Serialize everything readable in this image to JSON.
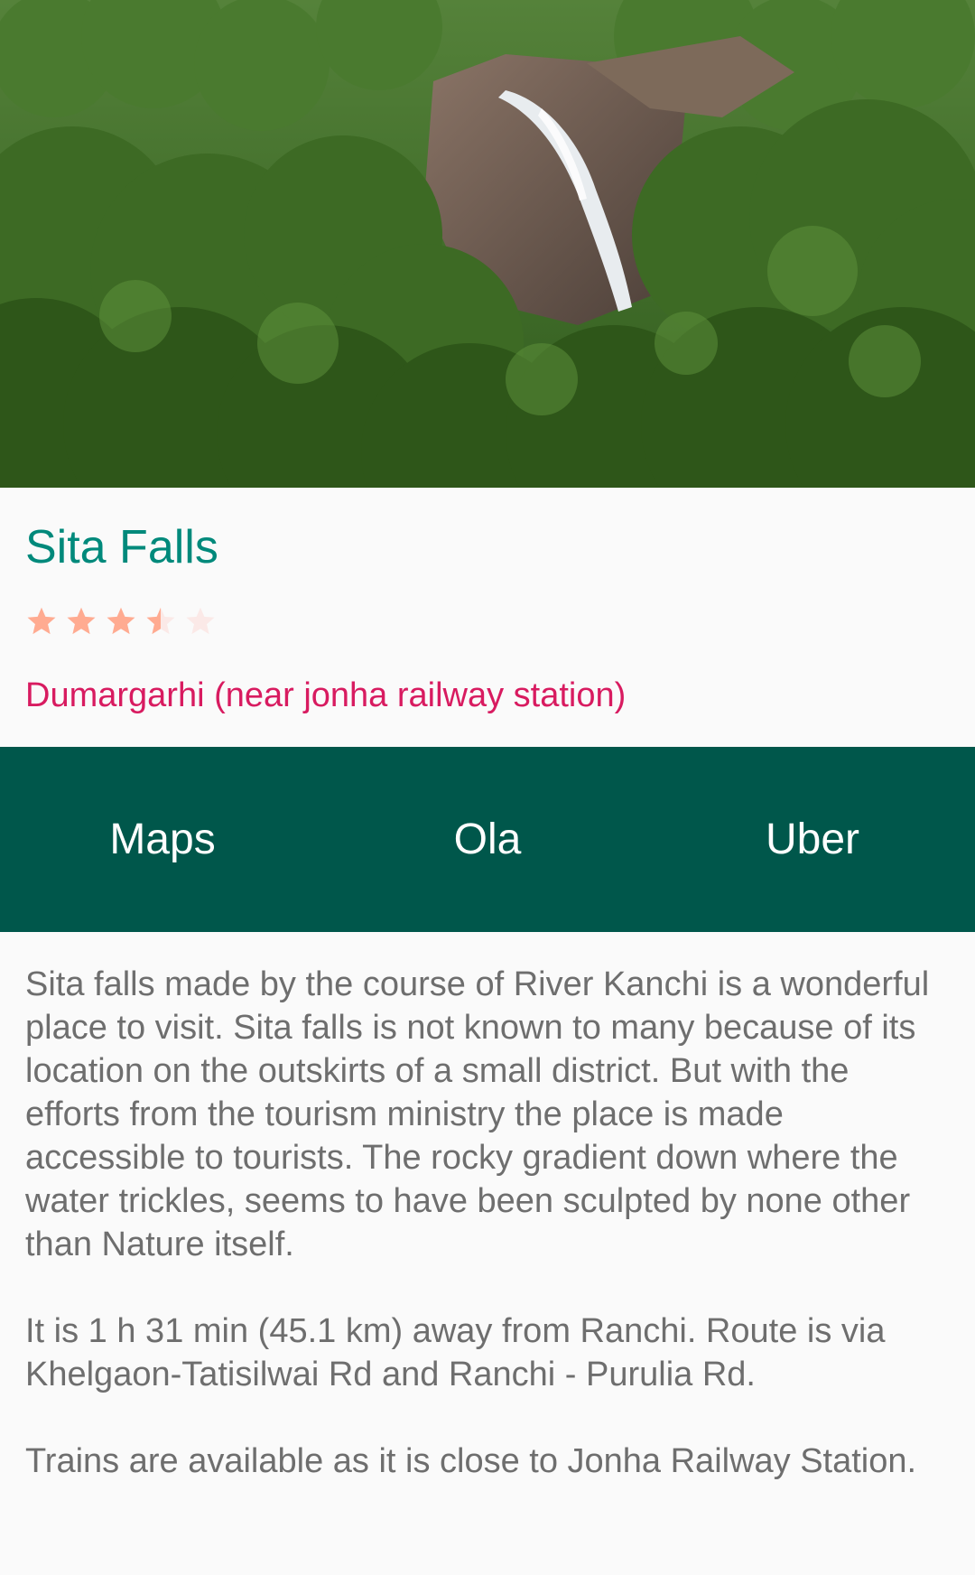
{
  "place": {
    "name": "Sita Falls",
    "rating": 3.5,
    "rating_max": 5,
    "location": "Dumargarhi (near jonha railway station)"
  },
  "actions": {
    "maps_label": "Maps",
    "ola_label": "Ola",
    "uber_label": "Uber"
  },
  "description": {
    "paragraphs": [
      "Sita falls made by the course of River Kanchi is a wonderful place to visit. Sita falls is not known to many because of its location on the outskirts of a small district. But with the efforts from the tourism ministry the place is made accessible to tourists. The rocky gradient down where the water trickles, seems to have been sculpted by none other than Nature itself.",
      "It is 1 h 31 min (45.1 km) away from Ranchi. Route is via Khelgaon-Tatisilwai Rd and Ranchi - Purulia Rd.",
      "Trains are available as it is close to Jonha Railway Station."
    ]
  },
  "colors": {
    "title": "#00897b",
    "location": "#d81b60",
    "action_bar": "#00574b",
    "star_filled": "#ffab91",
    "star_empty": "#fbe9e7",
    "body_text": "#6e6e6e"
  }
}
